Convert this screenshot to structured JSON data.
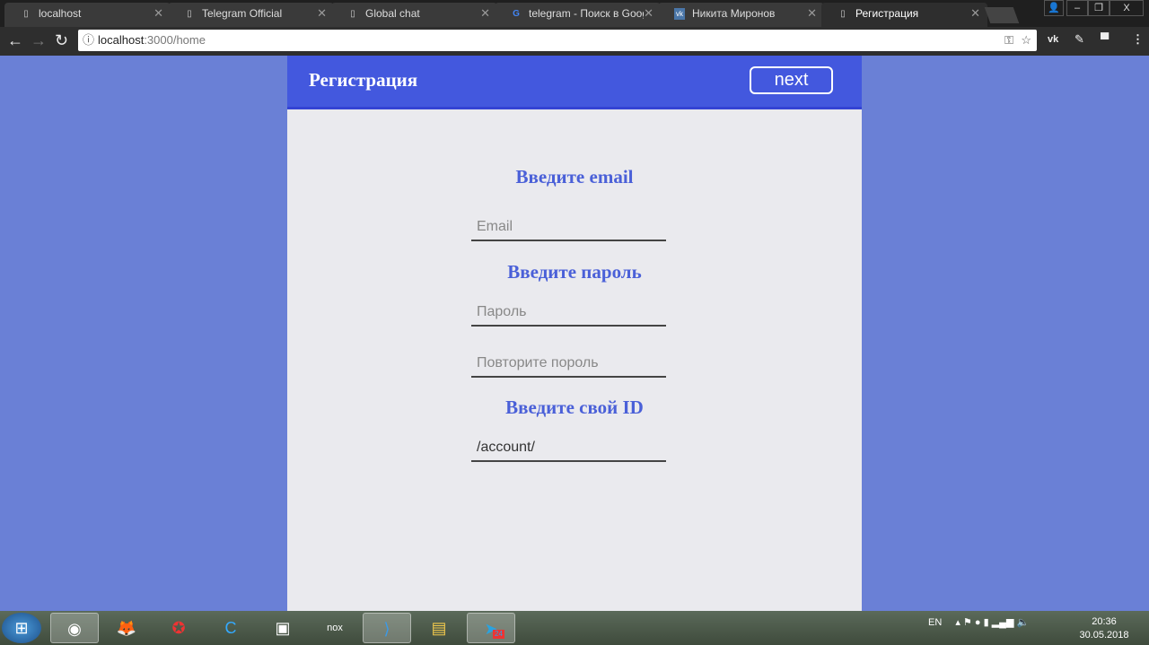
{
  "browser": {
    "tabs": [
      {
        "label": "localhost",
        "icon": "page-icon"
      },
      {
        "label": "Telegram Official",
        "icon": "page-icon"
      },
      {
        "label": "Global chat",
        "icon": "page-icon"
      },
      {
        "label": "telegram - Поиск в Goog",
        "icon": "google-icon"
      },
      {
        "label": "Никита Миронов",
        "icon": "vk-icon"
      },
      {
        "label": "Регистрация",
        "icon": "page-icon",
        "active": true
      }
    ],
    "url_host": "localhost",
    "url_path": ":3000/home"
  },
  "page": {
    "title": "Регистрация",
    "next_label": "next",
    "email_heading": "Введите email",
    "email_placeholder": "Email",
    "password_heading": "Введите пароль",
    "password_placeholder": "Пароль",
    "repeat_placeholder": "Повторите пороль",
    "id_heading": "Введите свой ID",
    "id_value": "/account/"
  },
  "colors": {
    "page_bg": "#6a80d6",
    "header": "#4358de",
    "heading_text": "#4a60d8",
    "panel": "#eaeaee"
  },
  "taskbar": {
    "lang": "EN",
    "time": "20:36",
    "date": "30.05.2018",
    "telegram_badge": "24"
  }
}
